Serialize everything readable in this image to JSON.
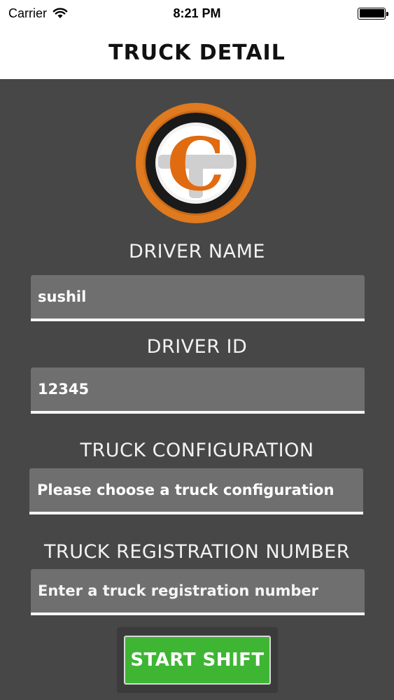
{
  "status_bar": {
    "carrier": "Carrier",
    "time": "8:21 PM"
  },
  "nav": {
    "title": "TRUCK DETAIL"
  },
  "logo": {
    "letter": "C",
    "colors": {
      "ring": "#e07a1f",
      "outer": "#1a1a1a",
      "inner": "#f2f2f2",
      "letter": "#e06b10"
    }
  },
  "form": {
    "driver_name": {
      "label": "DRIVER NAME",
      "value": "sushil"
    },
    "driver_id": {
      "label": "DRIVER ID",
      "value": "12345"
    },
    "truck_configuration": {
      "label": "TRUCK CONFIGURATION",
      "selected": "Please choose a truck configuration"
    },
    "truck_registration": {
      "label": "TRUCK REGISTRATION NUMBER",
      "placeholder": "Enter a truck registration number",
      "value": ""
    }
  },
  "actions": {
    "start_label": "START SHIFT"
  },
  "colors": {
    "background": "#474747",
    "field": "#6f6f6f",
    "button": "#3fb534"
  }
}
